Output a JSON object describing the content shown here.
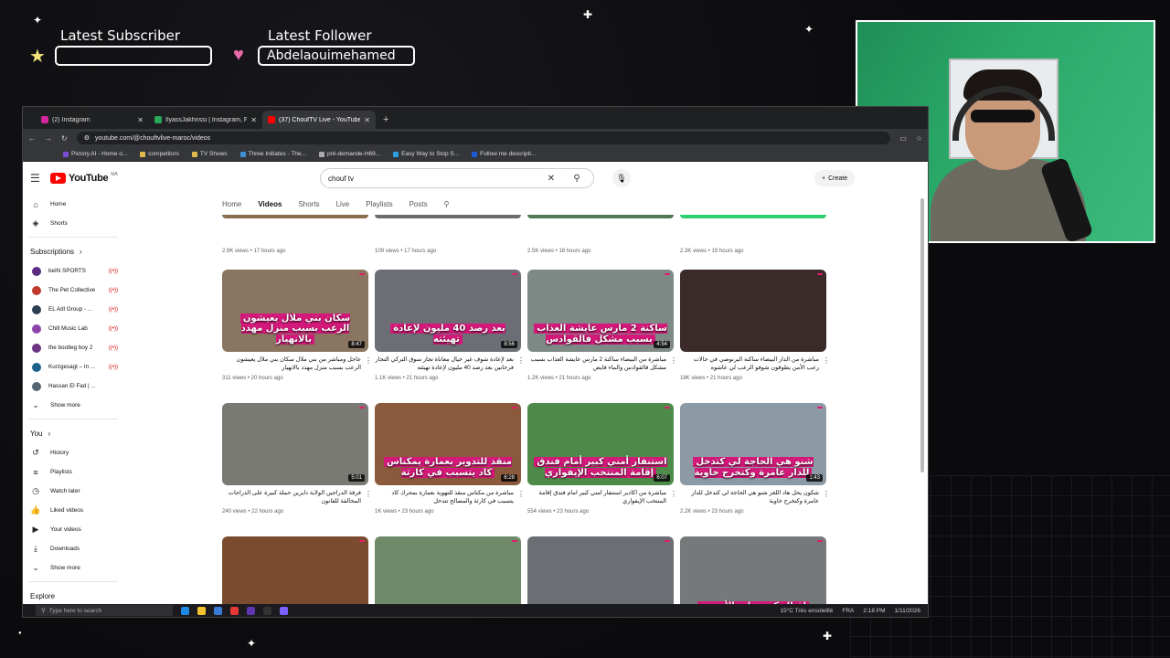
{
  "overlay": {
    "latest_subscriber_label": "Latest Subscriber",
    "latest_subscriber_value": "",
    "latest_follower_label": "Latest Follower",
    "latest_follower_value": "Abdelaouimehamed"
  },
  "browser": {
    "tabs": [
      {
        "label": "(2) Instagram",
        "color": "#d6249f"
      },
      {
        "label": "IlyassJakhrissi | Instagram, Face",
        "color": "#2aa75a"
      },
      {
        "label": "(37) ChoufTV Live - YouTube",
        "color": "#ff0000"
      }
    ],
    "url": "youtube.com/@chouftvlive-maroc/videos",
    "bookmarks": [
      "Pictory.AI - Home o...",
      "competitors",
      "TV Shows",
      "Three Initiates - The...",
      "pré-demande-H69...",
      "Easy Way to Stop S...",
      "Follow me descripti..."
    ]
  },
  "youtube": {
    "logo": "YouTube",
    "country_code": "MA",
    "search_query": "chouf tv",
    "create_label": "Create",
    "sidebar": {
      "home": "Home",
      "shorts": "Shorts",
      "subscriptions_label": "Subscriptions",
      "subscriptions": [
        {
          "name": "beIN SPORTS",
          "color": "#5a2d82"
        },
        {
          "name": "The Pet Collective",
          "color": "#c0392b"
        },
        {
          "name": "EL Adl Group - ...",
          "color": "#2c3e50"
        },
        {
          "name": "Chill Music Lab",
          "color": "#8e44ad"
        },
        {
          "name": "the bootleg boy 2",
          "color": "#6c3483"
        },
        {
          "name": "Kurzgesagt – In ...",
          "color": "#1f618d"
        },
        {
          "name": "Hassan El Fad | ...",
          "color": "#566573"
        }
      ],
      "show_more": "Show more",
      "you_label": "You",
      "you_items": [
        {
          "label": "History",
          "icon": "history-icon"
        },
        {
          "label": "Playlists",
          "icon": "playlist-icon"
        },
        {
          "label": "Watch later",
          "icon": "clock-icon"
        },
        {
          "label": "Liked videos",
          "icon": "thumb-up-icon"
        },
        {
          "label": "Your videos",
          "icon": "play-icon"
        },
        {
          "label": "Downloads",
          "icon": "download-icon"
        }
      ],
      "show_more_2": "Show more",
      "explore": "Explore"
    },
    "channel_tabs": [
      "Home",
      "Videos",
      "Shorts",
      "Live",
      "Playlists",
      "Posts"
    ],
    "top_row_meta": [
      "2.9K views • 17 hours ago",
      "109 views • 17 hours ago",
      "2.5K views • 18 hours ago",
      "2.3K views • 19 hours ago"
    ],
    "videos": [
      {
        "caption": "سكان بني ملال يعيشون الرعب بسبب منزل مهدد بالانهيار",
        "duration": "8:47",
        "title": "عاجل ومباشر من بني ملال سكان بني ملال يعيشون الرعب بسبب منزل مهدد بالانهيار",
        "meta": "311 views • 20 hours ago",
        "bg": "#8a7660"
      },
      {
        "caption": "بعد رصد 40 مليون لإعادة تهيئته",
        "duration": "8:56",
        "title": "بعد لإعادة شوف غير حيال معاناة تجار سوق التركي التجار فرحانين بعد رصد 40 مليون لإعادة تهيئته",
        "meta": "1.1K views • 21 hours ago",
        "bg": "#6b6f75"
      },
      {
        "caption": "ساكنة 2 مارس عايشة العذاب بسبب مشكل فالقوادس",
        "duration": "4:54",
        "title": "مباشرة من البيضاء ساكنة 2 مارس عايشة العذاب بسبب مشكل فالقوادس والماء فايض",
        "meta": "1.2K views • 21 hours ago",
        "bg": "#7d8a86"
      },
      {
        "caption": "",
        "duration": "",
        "title": "مباشرة من الدار البيضاء ساكنة البرنوصي في حالات رعب الأمن يطوقون شوفو الرعب لي عاشوه",
        "meta": "18K views • 21 hours ago",
        "bg": "#3a2a2a"
      },
      {
        "caption": "",
        "duration": "5:01",
        "title": "فرقة الدراجين الولاية دايرين حملة كبيرة على الدراجات المخالفة للقانون",
        "meta": "240 views • 22 hours ago",
        "bg": "#7a7a74"
      },
      {
        "caption": "منقذ للتدوير بعمارة يمكناس كاد يتسبب في كارثة",
        "duration": "6:28",
        "title": "مباشرة من مكناس منقذ للتهوية بعمارة بمحرك كاد يتسبب في كارثة والمصالح تتدخل",
        "meta": "1K views • 23 hours ago",
        "bg": "#8b5a3c"
      },
      {
        "caption": "استنفار أمني كبير أمام فندق إقامة المنتخب الإيفواري",
        "duration": "6:07",
        "title": "مباشرة من اكادير استنفار أمني كبير امام فندق إقامة المنتخب الإيفواري",
        "meta": "554 views • 23 hours ago",
        "bg": "#4e8a4a"
      },
      {
        "caption": "شنو هي الحاجة لي كتدخل للدار عامرة وكتخرج خاوية",
        "duration": "1:43",
        "title": "شكون يحل هاد اللغز شنو هي الحاجة لي كتدخل للدار عامرة وكتخرج خاوية",
        "meta": "2.2K views • 23 hours ago",
        "bg": "#8c9aa5"
      },
      {
        "caption": "",
        "duration": "",
        "title": "",
        "meta": "",
        "bg": "#7a4b2f"
      },
      {
        "caption": "",
        "duration": "",
        "title": "",
        "meta": "",
        "bg": "#6e8a68"
      },
      {
        "caption": "",
        "duration": "",
        "title": "",
        "meta": "",
        "bg": "#6b6f73"
      },
      {
        "caption": "إقبال كبير على الأضحية",
        "duration": "",
        "title": "",
        "meta": "",
        "bg": "#75797a"
      }
    ]
  },
  "taskbar": {
    "search_placeholder": "Type here to search",
    "weather": "15°C Très ensoleillé",
    "lang": "FRA",
    "time": "2:18 PM",
    "date": "1/11/2026"
  }
}
